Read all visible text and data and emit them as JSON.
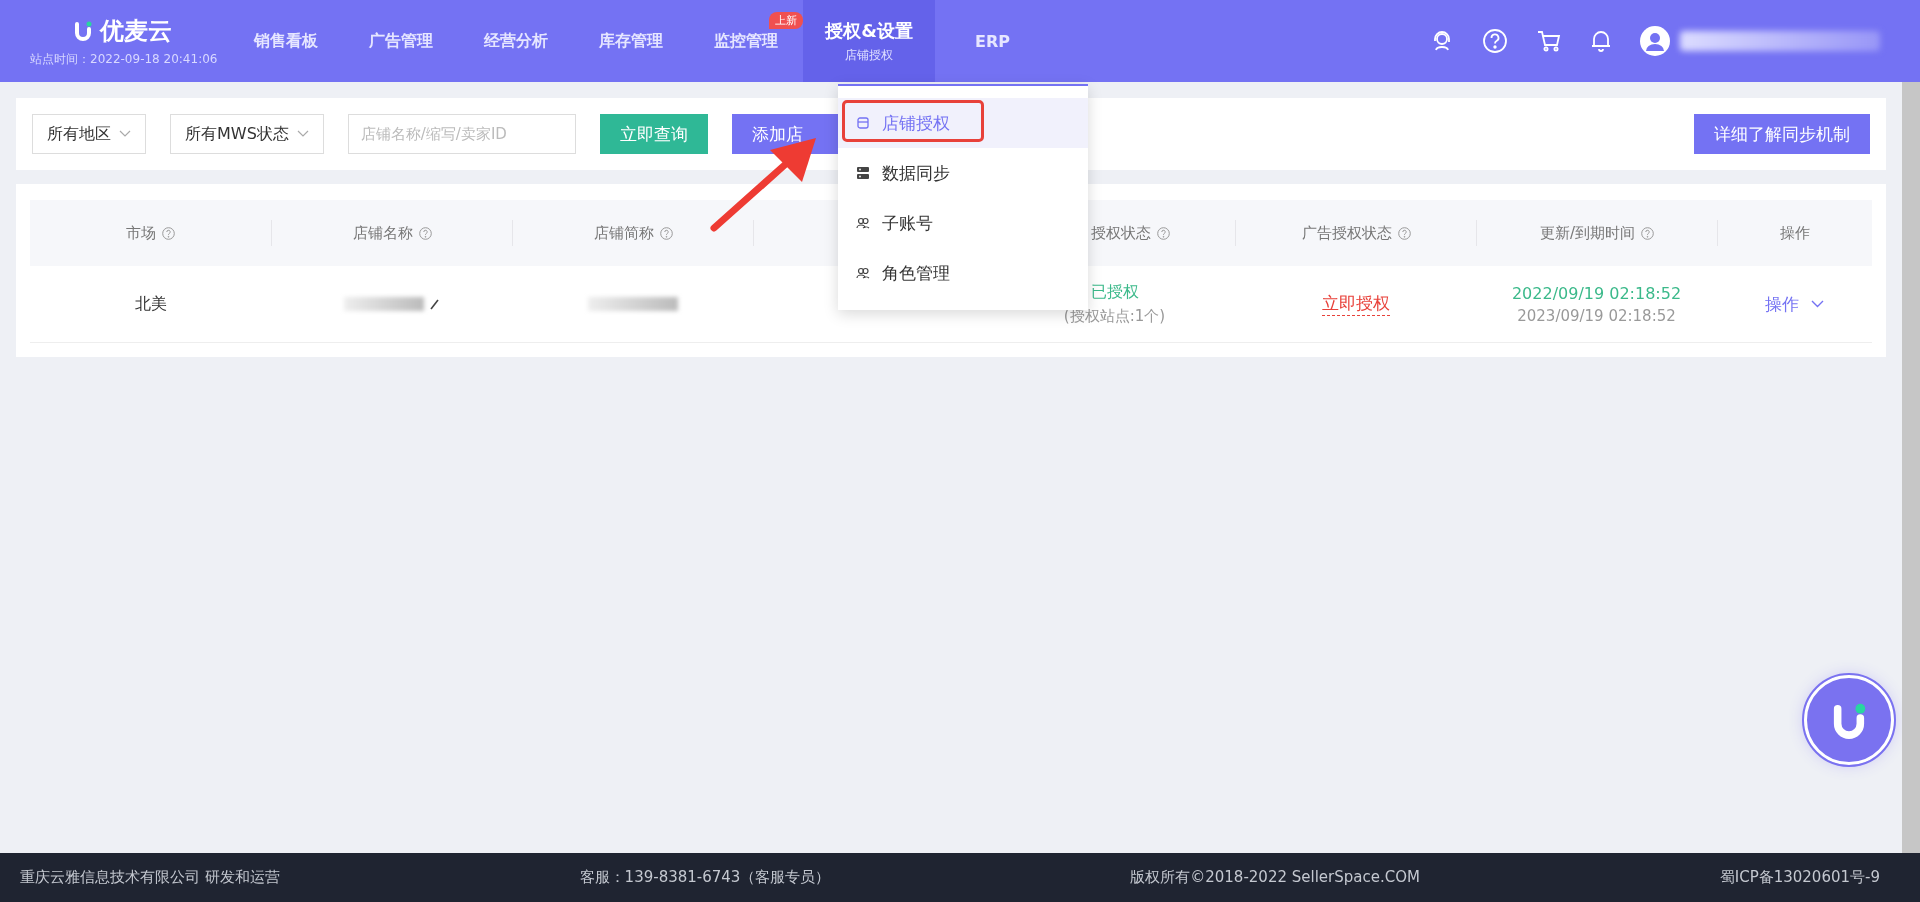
{
  "header": {
    "logo": "优麦云",
    "site_time": "站点时间：2022-09-18 20:41:06",
    "nav": [
      {
        "label": "销售看板",
        "selected": false
      },
      {
        "label": "广告管理",
        "selected": false
      },
      {
        "label": "经营分析",
        "selected": false
      },
      {
        "label": "库存管理",
        "selected": false
      },
      {
        "label": "监控管理",
        "selected": false,
        "badge": "上新"
      },
      {
        "label": "授权&设置",
        "sub": "店铺授权",
        "selected": true
      },
      {
        "label": "ERP",
        "selected": false
      }
    ]
  },
  "toolbar": {
    "filters": [
      "所有地区",
      "所有MWS状态"
    ],
    "search": {
      "placeholder": "店铺名称/缩写/卖家ID"
    },
    "buttons": [
      {
        "label": "立即查询",
        "kind": "query"
      },
      {
        "label": "添加店",
        "kind": "add"
      }
    ],
    "help_button": "详细了解同步机制"
  },
  "table": {
    "columns": [
      {
        "label": "市场",
        "help": true
      },
      {
        "label": "店铺名称",
        "help": true
      },
      {
        "label": "店铺简称",
        "help": true
      },
      {
        "label": "授权状态",
        "help": true
      },
      {
        "label": "广告授权状态",
        "help": true
      },
      {
        "label": "更新/到期时间",
        "help": true
      },
      {
        "label": "操作",
        "help": false
      }
    ],
    "rows": [
      {
        "market": "北美",
        "mws_status": {
          "text": "已授权",
          "kind": "ok"
        },
        "mws_sites": "(授权站点:1个)",
        "ad_status": {
          "text": "立即授权",
          "kind": "pending"
        },
        "updated": "2022/09/19 02:18:52",
        "expires": "2023/09/19 02:18:52",
        "action": "操作"
      }
    ]
  },
  "dropdown": {
    "items": [
      {
        "label": "店铺授权",
        "kind": "store",
        "selected": true
      },
      {
        "label": "数据同步",
        "kind": "server",
        "selected": false
      },
      {
        "label": "子账号",
        "kind": "users",
        "selected": false
      },
      {
        "label": "角色管理",
        "kind": "users",
        "selected": false
      }
    ]
  },
  "footer": [
    "重庆云雅信息技术有限公司 研发和运营",
    "客服：139-8381-6743（客服专员）",
    "版权所有©2018-2022 SellerSpace.COM",
    "蜀ICP备13020601号-9"
  ]
}
